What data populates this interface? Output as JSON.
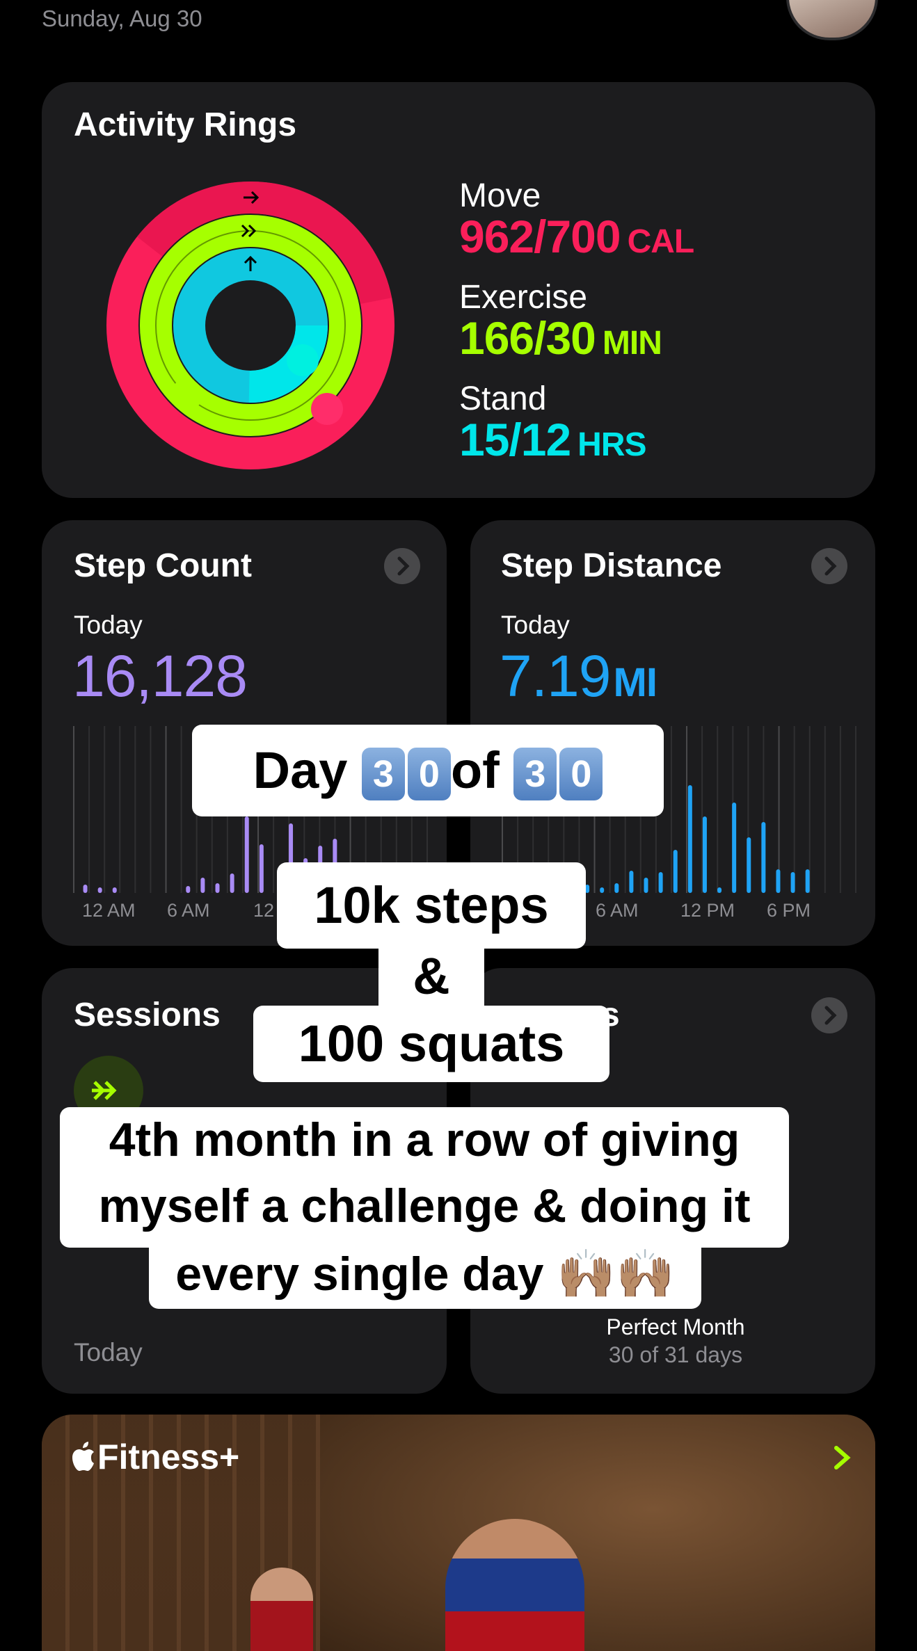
{
  "header": {
    "date": "Sunday, Aug 30"
  },
  "activity": {
    "title": "Activity Rings",
    "move": {
      "label": "Move",
      "value": "962/700",
      "unit": "CAL",
      "color": "#fa1f5a",
      "progress": 1.374
    },
    "exercise": {
      "label": "Exercise",
      "value": "166/30",
      "unit": "MIN",
      "color": "#a6ff00",
      "progress": 5.53
    },
    "stand": {
      "label": "Stand",
      "value": "15/12",
      "unit": "HRS",
      "color": "#00e6ea",
      "progress": 1.25
    }
  },
  "steps": {
    "title": "Step Count",
    "period": "Today",
    "value": "16,128",
    "color": "#a98bf5",
    "axis": [
      "12 AM",
      "6 AM",
      "12"
    ]
  },
  "distance": {
    "title": "Step Distance",
    "period": "Today",
    "value": "7.19",
    "unit": "MI",
    "color": "#1fa3f5",
    "axis": [
      "6 AM",
      "12 PM",
      "6 PM"
    ]
  },
  "sessions": {
    "title": "Sessions",
    "footer": "Today"
  },
  "awards": {
    "title_fragment": "s",
    "award_name": "Perfect Month",
    "award_detail": "30 of 31 days"
  },
  "fitness_plus": {
    "title": "Fitness+"
  },
  "overlays": {
    "day_prefix": "Day",
    "day_digits_1": [
      "3",
      "0"
    ],
    "day_mid": "of",
    "day_digits_2": [
      "3",
      "0"
    ],
    "steps_line": "10k steps",
    "amp_line": "&",
    "squats_line": "100 squats",
    "caption_line_1": "4th month in a row of giving",
    "caption_line_2": "myself a challenge & doing it",
    "caption_line_3": "every single day 🙌🏽🙌🏽"
  }
}
